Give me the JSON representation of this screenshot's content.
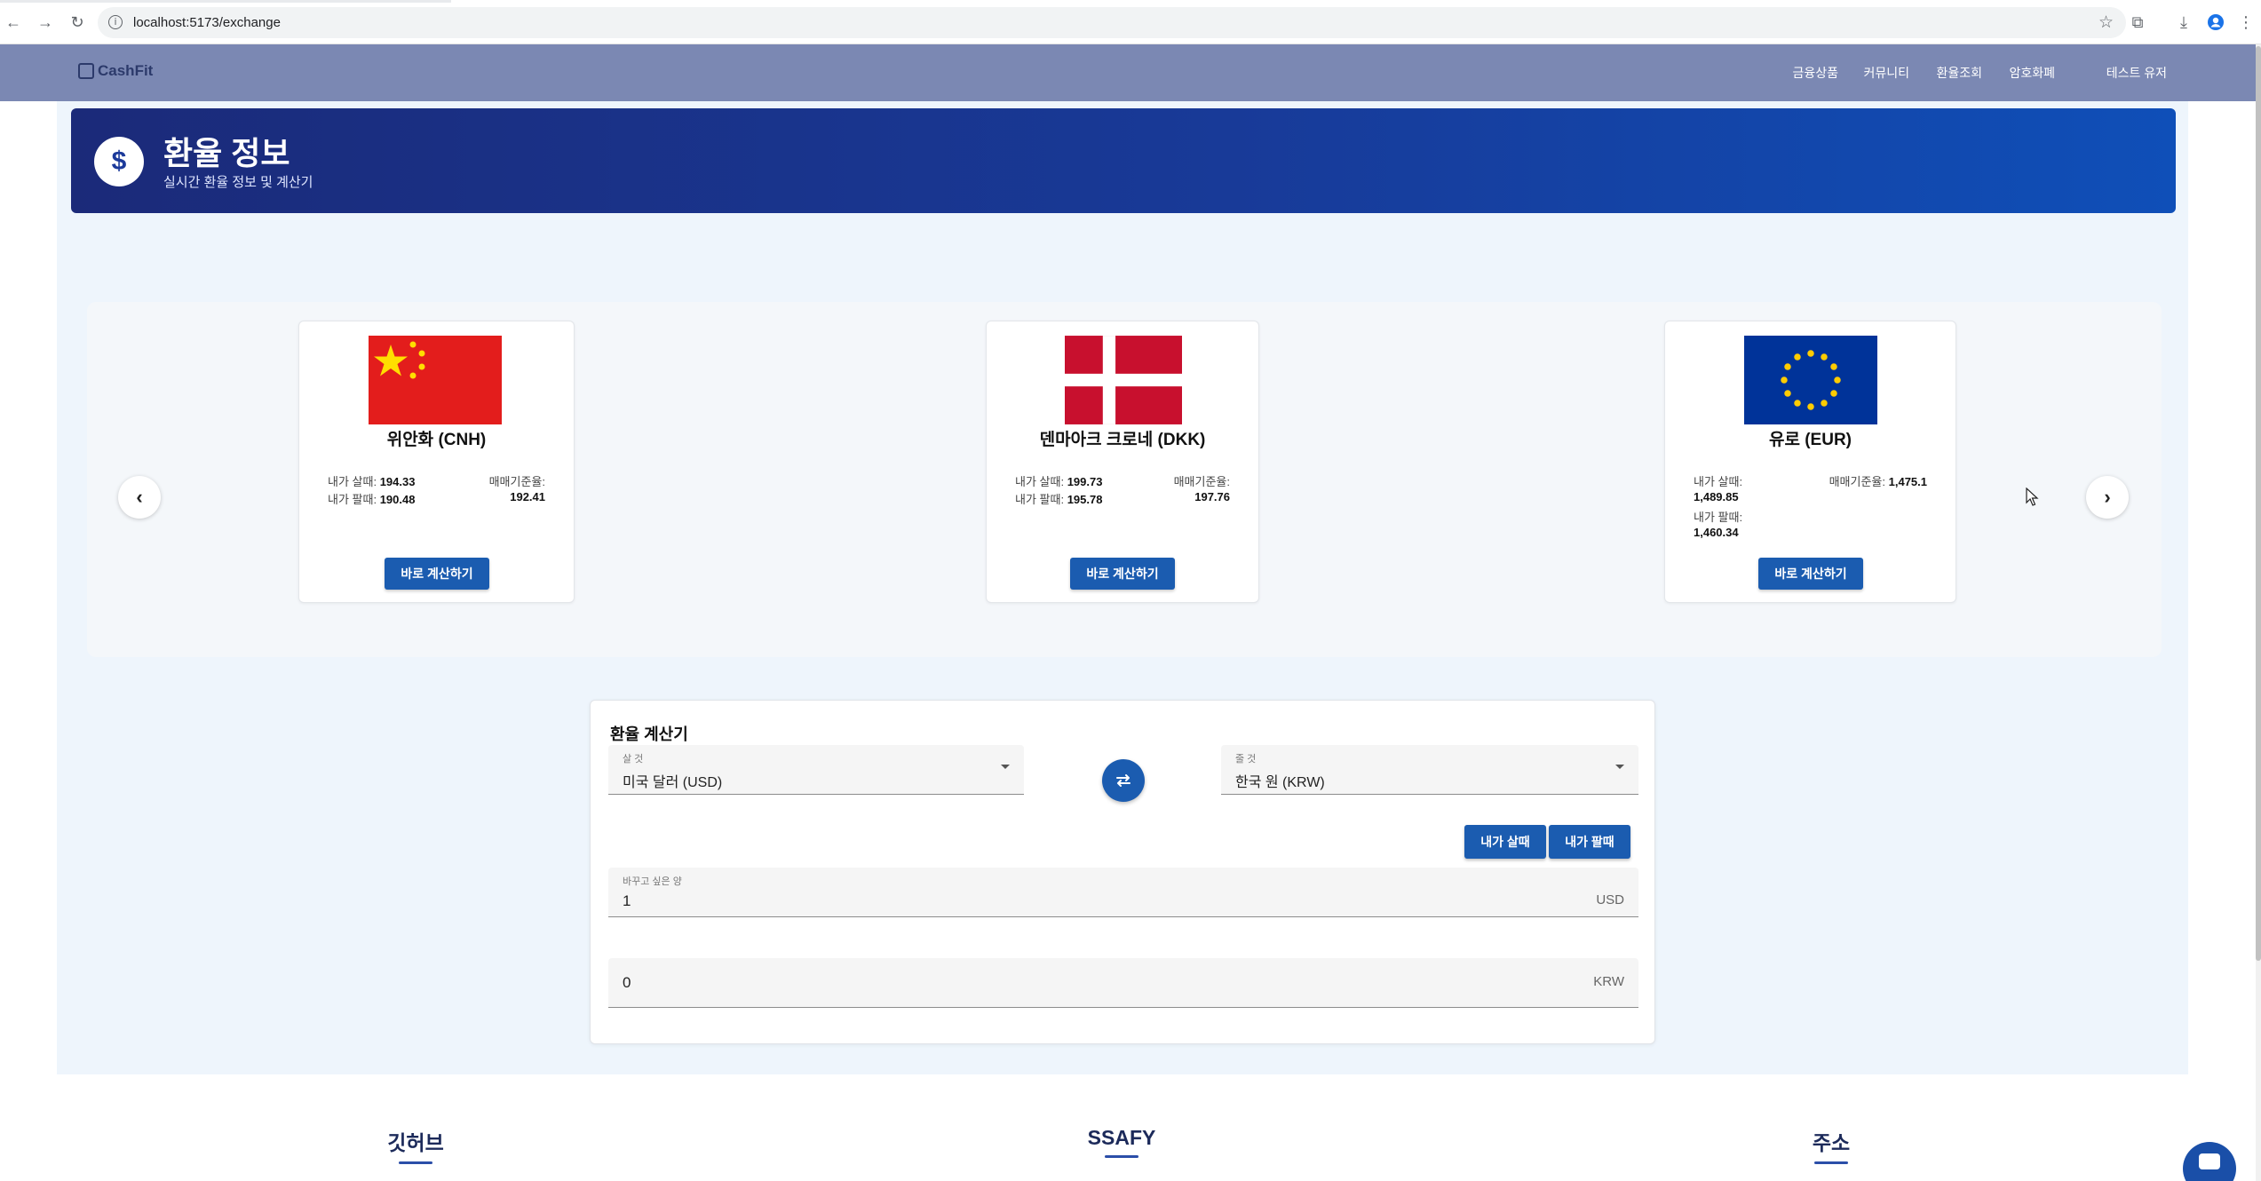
{
  "browser": {
    "url": "localhost:5173/exchange"
  },
  "header": {
    "logo_text": "CashFit",
    "nav": [
      {
        "label": "금융상품"
      },
      {
        "label": "커뮤니티"
      },
      {
        "label": "환율조회"
      },
      {
        "label": "암호화폐"
      },
      {
        "label": "테스트 유저"
      }
    ]
  },
  "hero": {
    "icon_symbol": "$",
    "title": "환율 정보",
    "subtitle": "실시간 환율 정보 및 계산기"
  },
  "carousel": {
    "prev_symbol": "‹",
    "next_symbol": "›",
    "cards": [
      {
        "flag": "china-flag-icon",
        "title": "위안화 (CNH)",
        "buy_label": "내가 살때:",
        "buy_value": "194.33",
        "sell_label": "내가 팔때:",
        "sell_value": "190.48",
        "base_label": "매매기준율:",
        "base_value": "192.41",
        "button": "바로 계산하기"
      },
      {
        "flag": "denmark-flag-icon",
        "title": "덴마아크 크로네 (DKK)",
        "buy_label": "내가 살때:",
        "buy_value": "199.73",
        "sell_label": "내가 팔때:",
        "sell_value": "195.78",
        "base_label": "매매기준율:",
        "base_value": "197.76",
        "button": "바로 계산하기"
      },
      {
        "flag": "eu-flag-icon",
        "title": "유로 (EUR)",
        "buy_label": "내가 살때:",
        "buy_value": "1,489.85",
        "sell_label": "내가 팔때:",
        "sell_value": "1,460.34",
        "base_label": "매매기준율:",
        "base_value": "1,475.1",
        "button": "바로 계산하기"
      }
    ]
  },
  "calculator": {
    "title": "환율 계산기",
    "from": {
      "label": "살 것",
      "value": "미국 달러 (USD)"
    },
    "to": {
      "label": "줄 것",
      "value": "한국 원 (KRW)"
    },
    "buy_button": "내가 살때",
    "sell_button": "내가 팔때",
    "amount": {
      "label": "바꾸고 싶은 양",
      "value": "1",
      "unit": "USD"
    },
    "result": {
      "value": "0",
      "unit": "KRW"
    }
  },
  "footer": {
    "columns": [
      {
        "title": "깃허브"
      },
      {
        "title": "SSAFY"
      },
      {
        "title": "주소"
      }
    ]
  },
  "colors": {
    "header_bg": "#7b88b3",
    "primary": "#1b5cb0",
    "hero_start": "#1b2a79",
    "hero_end": "#0f4fb8",
    "page_bg": "#eef5fc"
  }
}
